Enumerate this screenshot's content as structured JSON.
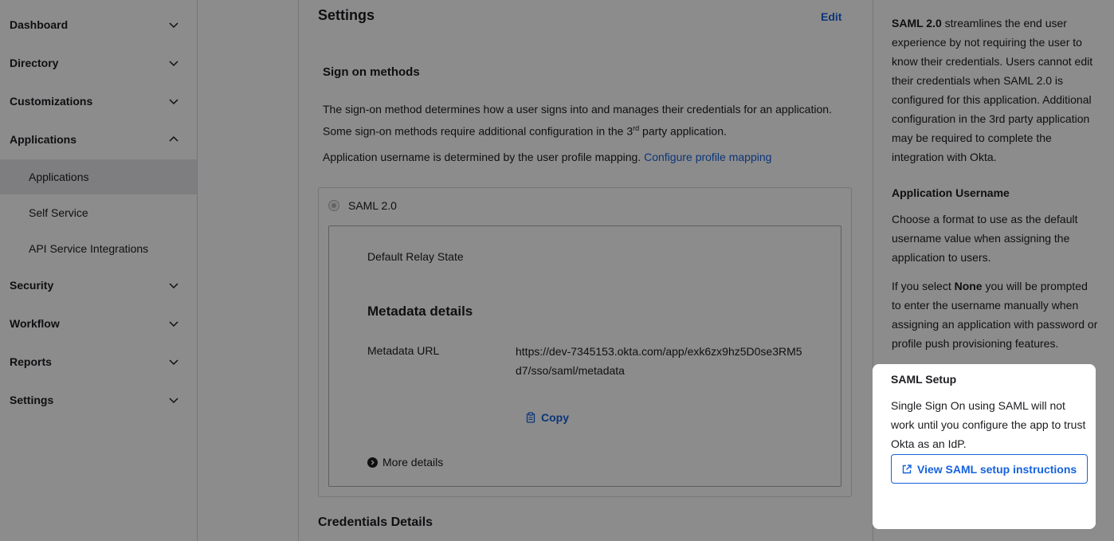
{
  "sidebar": {
    "items": [
      {
        "label": "Dashboard",
        "expanded": false
      },
      {
        "label": "Directory",
        "expanded": false
      },
      {
        "label": "Customizations",
        "expanded": false
      },
      {
        "label": "Applications",
        "expanded": true
      },
      {
        "label": "Security",
        "expanded": false
      },
      {
        "label": "Workflow",
        "expanded": false
      },
      {
        "label": "Reports",
        "expanded": false
      },
      {
        "label": "Settings",
        "expanded": false
      }
    ],
    "sub_items": [
      {
        "label": "Applications",
        "active": true
      },
      {
        "label": "Self Service",
        "active": false
      },
      {
        "label": "API Service Integrations",
        "active": false
      }
    ]
  },
  "main": {
    "title": "Settings",
    "edit_label": "Edit",
    "sign_on": {
      "title": "Sign on methods",
      "description_part1": "The sign-on method determines how a user signs into and manages their credentials for an application. Some sign-on methods require additional configuration in the 3",
      "description_sup": "rd",
      "description_part2": " party application.",
      "username_text": "Application username is determined by the user profile mapping. ",
      "username_link": "Configure profile mapping",
      "method_label": "SAML 2.0",
      "relay_state_label": "Default Relay State",
      "metadata_title": "Metadata details",
      "metadata_url_label": "Metadata URL",
      "metadata_url": "https://dev-7345153.okta.com/app/exk6zx9hz5D0se3RM5d7/sso/saml/metadata",
      "copy_label": "Copy",
      "more_details_label": "More details"
    },
    "credentials_title": "Credentials Details"
  },
  "help": {
    "saml_intro_bold": "SAML 2.0",
    "saml_intro_rest": " streamlines the end user experience by not requiring the user to know their credentials. Users cannot edit their credentials when SAML 2.0 is configured for this application. Additional configuration in the 3rd party application may be required to complete the integration with Okta.",
    "username_heading": "Application Username",
    "username_text": "Choose a format to use as the default username value when assigning the application to users.",
    "none_text_pre": "If you select ",
    "none_text_bold": "None",
    "none_text_post": " you will be prompted to enter the username manually when assigning an application with password or profile push provisioning features.",
    "setup_card": {
      "title": "SAML Setup",
      "text": "Single Sign On using SAML will not work until you configure the app to trust Okta as an IdP.",
      "button_label": "View SAML setup instructions"
    }
  }
}
